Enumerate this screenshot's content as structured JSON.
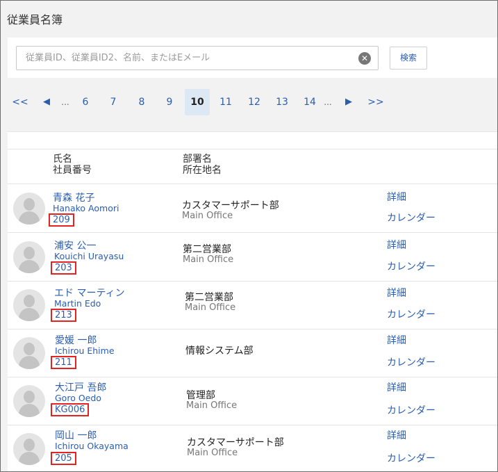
{
  "page": {
    "title": "従業員名簿"
  },
  "search": {
    "placeholder": "従業員ID、従業員ID2、名前、またはEメール",
    "value": "",
    "clear_symbol": "✕",
    "button_label": "検索"
  },
  "pagination": {
    "first": "<<",
    "prev": "◀",
    "ellipsis_left": "...",
    "pages": [
      "6",
      "7",
      "8",
      "9",
      "10",
      "11",
      "12",
      "13",
      "14"
    ],
    "current": "10",
    "ellipsis_right": "...",
    "next": "▶",
    "last": ">>"
  },
  "table": {
    "header": {
      "name": "氏名",
      "employee_no": "社員番号",
      "department": "部署名",
      "location": "所在地名"
    },
    "rows": [
      {
        "name": "青森 花子",
        "romaji": "Hanako Aomori",
        "id": "209",
        "department": "カスタマーサポート部",
        "location": "Main Office",
        "detail": "詳細",
        "calendar": "カレンダー"
      },
      {
        "name": "浦安 公一",
        "romaji": "Kouichi Urayasu",
        "id": "203",
        "department": "第二営業部",
        "location": "Main Office",
        "detail": "詳細",
        "calendar": "カレンダー"
      },
      {
        "name": "エド マーティン",
        "romaji": "Martin Edo",
        "id": "213",
        "department": "第二営業部",
        "location": "Main Office",
        "detail": "詳細",
        "calendar": "カレンダー"
      },
      {
        "name": "愛媛 一郎",
        "romaji": "Ichirou Ehime",
        "id": "211",
        "department": "情報システム部",
        "location": "",
        "detail": "詳細",
        "calendar": "カレンダー"
      },
      {
        "name": "大江戸 吾郎",
        "romaji": "Goro Oedo",
        "id": "KG006",
        "department": "管理部",
        "location": "Main Office",
        "detail": "詳細",
        "calendar": "カレンダー"
      },
      {
        "name": "岡山 一郎",
        "romaji": "Ichirou Okayama",
        "id": "205",
        "department": "カスタマーサポート部",
        "location": "Main Office",
        "detail": "詳細",
        "calendar": "カレンダー"
      }
    ]
  },
  "colors": {
    "link": "#2a5db0",
    "highlight_box": "#e52222",
    "current_page_bg": "#dde8f5",
    "background": "#f2f2f2"
  },
  "icons": {
    "clear": "close-circle-icon",
    "avatar": "user-placeholder-icon",
    "prev": "triangle-left-icon",
    "next": "triangle-right-icon"
  }
}
